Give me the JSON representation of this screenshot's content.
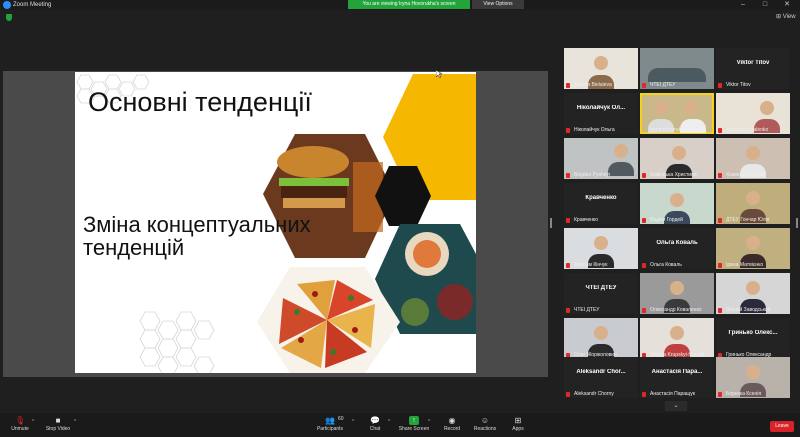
{
  "titlebar": {
    "app_title": "Zoom Meeting",
    "viewing_banner": "You are viewing Iryna Hovorukha's screen",
    "view_options": "View Options",
    "minimize": "–",
    "maximize": "□",
    "close": "✕"
  },
  "view_label": "View",
  "slide": {
    "title": "Основні тенденції",
    "subtitle": "Зміна концептуальних тенденцій"
  },
  "participants": [
    {
      "label": "Tatiana Bielaieva",
      "name_text": "",
      "mic_muted": true
    },
    {
      "label": "ЧТЕІ ДТЕУ",
      "name_text": "",
      "mic_muted": true
    },
    {
      "label": "Viktor Titov",
      "name_text": "Viktor Titov",
      "mic_muted": true
    },
    {
      "label": "Ніколайчук Ольга",
      "name_text": "Ніколайчук  Ол...",
      "mic_muted": true
    },
    {
      "label": "Iryna Hovorukha",
      "name_text": "",
      "mic_muted": false
    },
    {
      "label": "Tetyana Kovalenko",
      "name_text": "",
      "mic_muted": true
    },
    {
      "label": "Bogdan Pyshnyi",
      "name_text": "",
      "mic_muted": true
    },
    {
      "label": "Камінська Христина",
      "name_text": "",
      "mic_muted": true
    },
    {
      "label": "Хоменко Вікторія",
      "name_text": "",
      "mic_muted": true
    },
    {
      "label": "Кравченко",
      "name_text": "Кравченко",
      "mic_muted": true
    },
    {
      "label": "Вадим Гордей",
      "name_text": "",
      "mic_muted": true
    },
    {
      "label": "ДТЕУ Гончар Юлія",
      "name_text": "",
      "mic_muted": true
    },
    {
      "label": "Максим Кінчук",
      "name_text": "",
      "mic_muted": true
    },
    {
      "label": "Ольга Коваль",
      "name_text": "Ольга Коваль",
      "mic_muted": true
    },
    {
      "label": "Ірина Матвієнко",
      "name_text": "",
      "mic_muted": true
    },
    {
      "label": "ЧТЕІ ДТЕУ",
      "name_text": "ЧТЕІ ДТЕУ",
      "mic_muted": true
    },
    {
      "label": "Олександр Коваленко",
      "name_text": "",
      "mic_muted": true
    },
    {
      "label": "Віталій Заводський",
      "name_text": "",
      "mic_muted": true
    },
    {
      "label": "Олег Жоржолович",
      "name_text": "",
      "mic_muted": true
    },
    {
      "label": "Tetiana Krupskyi-Haradii",
      "name_text": "",
      "mic_muted": true
    },
    {
      "label": "Гринько Олександр",
      "name_text": "Гринько  Олекс...",
      "mic_muted": true
    },
    {
      "label": "Aleksandr Chorny",
      "name_text": "Aleksandr  Chor...",
      "mic_muted": true
    },
    {
      "label": "Анастасія Паращук",
      "name_text": "Анастасія  Пара...",
      "mic_muted": true
    },
    {
      "label": "Березка Ксенія",
      "name_text": "",
      "mic_muted": true
    }
  ],
  "expand_arrow": "⌄",
  "toolbar": {
    "unmute": "Unmute",
    "stop_video": "Stop Video",
    "participants": "Participants",
    "participants_count": "60",
    "chat": "Chat",
    "share_screen": "Share Screen",
    "record": "Record",
    "reactions": "Reactions",
    "apps": "Apps",
    "leave": "Leave"
  },
  "colors": {
    "accent_yellow": "#f5b700",
    "share_green": "#23a33b",
    "leave_red": "#d9232b"
  }
}
